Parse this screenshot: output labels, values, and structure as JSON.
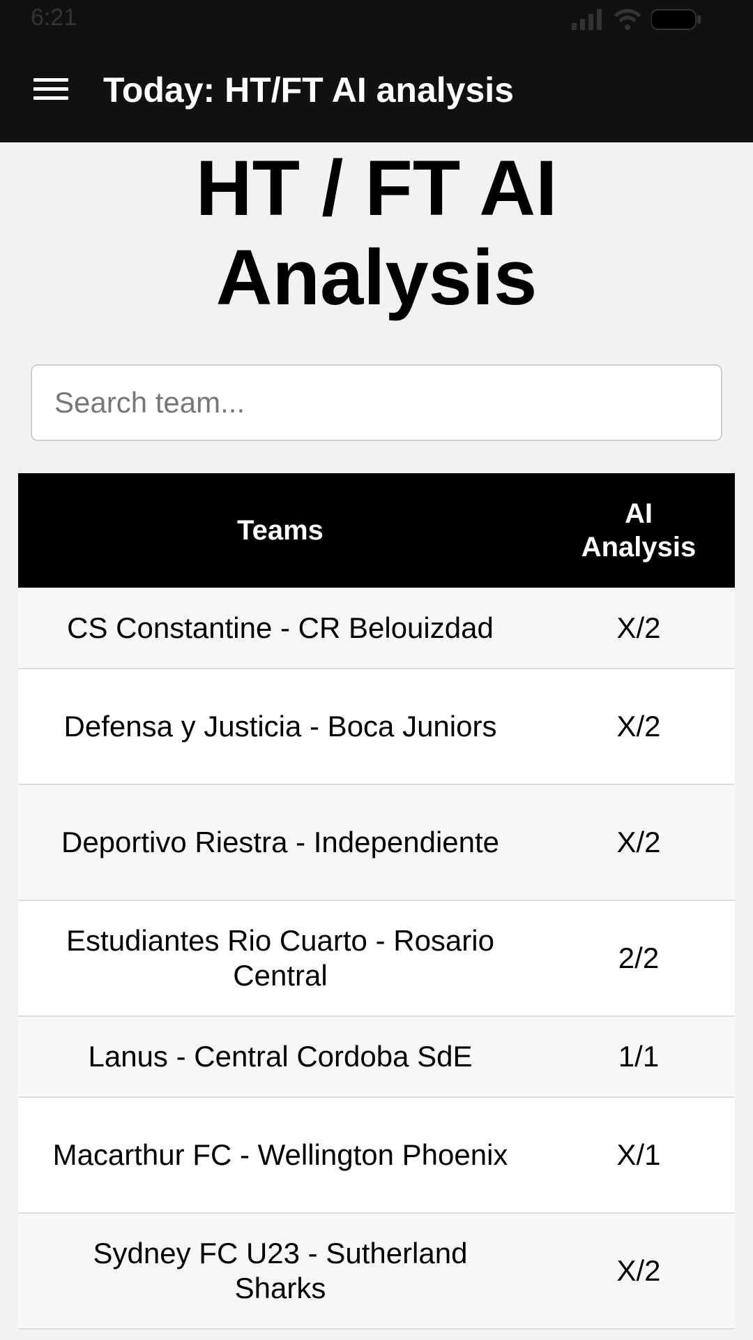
{
  "status_bar": {
    "time": "6:21"
  },
  "app_bar": {
    "title": "Today: HT/FT AI analysis"
  },
  "page": {
    "title_line1": "HT / FT AI",
    "title_line2": "Analysis"
  },
  "search": {
    "placeholder": "Search team...",
    "value": ""
  },
  "table": {
    "headers": {
      "teams": "Teams",
      "ai_line1": "AI",
      "ai_line2": "Analysis"
    },
    "rows": [
      {
        "teams": "CS Constantine - CR Belouizdad",
        "analysis": "X/2"
      },
      {
        "teams": "Defensa y Justicia - Boca Juniors",
        "analysis": "X/2"
      },
      {
        "teams": "Deportivo Riestra - Independiente",
        "analysis": "X/2"
      },
      {
        "teams": "Estudiantes Rio Cuarto - Rosario Central",
        "analysis": "2/2"
      },
      {
        "teams": "Lanus - Central Cordoba SdE",
        "analysis": "1/1"
      },
      {
        "teams": "Macarthur FC - Wellington Phoenix",
        "analysis": "X/1"
      },
      {
        "teams": "Sydney FC U23 - Sutherland Sharks",
        "analysis": "X/2"
      }
    ]
  },
  "colors": {
    "app_bar_bg": "#111111",
    "header_bg": "#000000",
    "row_alt_bg": "#f7f7f7"
  }
}
